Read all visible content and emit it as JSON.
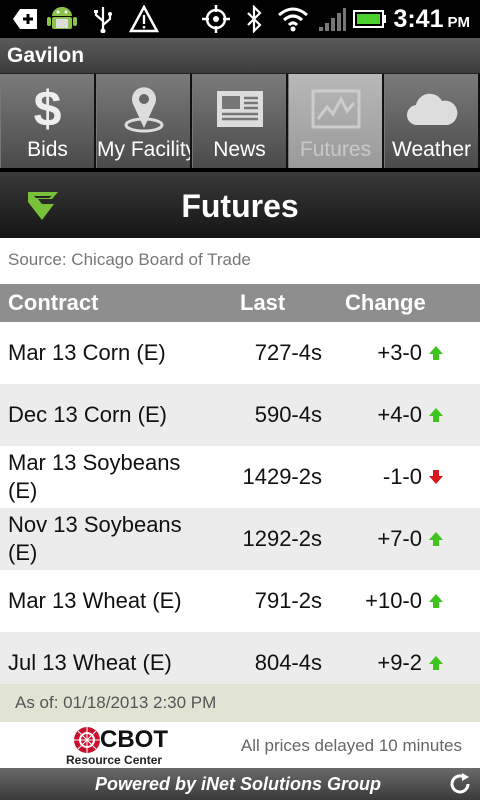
{
  "status_bar": {
    "time": "3:41",
    "ampm": "PM",
    "icons": [
      "add-notification-icon",
      "android-icon",
      "usb-icon",
      "warning-icon",
      "gps-icon",
      "bluetooth-icon",
      "wifi-icon",
      "signal-icon",
      "battery-icon"
    ]
  },
  "app": {
    "title": "Gavilon"
  },
  "tabs": [
    {
      "label": "Bids",
      "icon": "dollar-icon",
      "active": false
    },
    {
      "label": "My Facility",
      "icon": "location-pin-icon",
      "active": false
    },
    {
      "label": "News",
      "icon": "newspaper-icon",
      "active": false
    },
    {
      "label": "Futures",
      "icon": "chart-icon",
      "active": true
    },
    {
      "label": "Weather",
      "icon": "cloud-icon",
      "active": false
    }
  ],
  "header": {
    "title": "Futures",
    "logo": "gavilon-logo"
  },
  "source": "Source: Chicago Board of Trade",
  "table": {
    "columns": [
      "Contract",
      "Last",
      "Change"
    ],
    "rows": [
      {
        "contract": "Mar 13 Corn (E)",
        "last": "727-4s",
        "change": "+3-0",
        "direction": "up"
      },
      {
        "contract": "Dec 13 Corn (E)",
        "last": "590-4s",
        "change": "+4-0",
        "direction": "up"
      },
      {
        "contract": "Mar 13 Soybeans (E)",
        "last": "1429-2s",
        "change": "-1-0",
        "direction": "down"
      },
      {
        "contract": "Nov 13 Soybeans (E)",
        "last": "1292-2s",
        "change": "+7-0",
        "direction": "up"
      },
      {
        "contract": "Mar 13 Wheat (E)",
        "last": "791-2s",
        "change": "+10-0",
        "direction": "up"
      },
      {
        "contract": "Jul 13 Wheat (E)",
        "last": "804-4s",
        "change": "+9-2",
        "direction": "up"
      }
    ]
  },
  "as_of": "As of: 01/18/2013 2:30 PM",
  "footer": {
    "cbot_logo_text": "CBOT",
    "cbot_sub": "Resource Center",
    "delayed": "All prices delayed 10 minutes",
    "powered_by": "Powered by iNet Solutions Group"
  },
  "colors": {
    "up": "#3ec41a",
    "down": "#d8161b",
    "header_gray": "#8e8e8e",
    "as_of_bg": "#e2e4d3"
  }
}
